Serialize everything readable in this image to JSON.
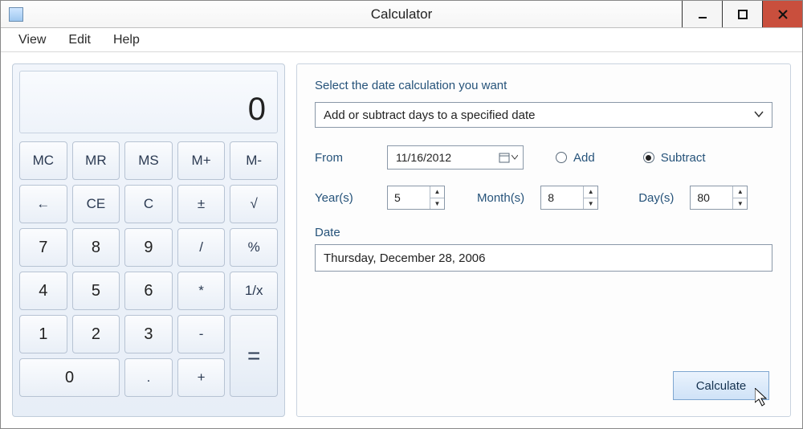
{
  "window": {
    "title": "Calculator"
  },
  "menu": {
    "view": "View",
    "edit": "Edit",
    "help": "Help"
  },
  "calc": {
    "display": "0",
    "keys": {
      "mc": "MC",
      "mr": "MR",
      "ms": "MS",
      "mplus": "M+",
      "mminus": "M-",
      "back": "←",
      "ce": "CE",
      "c": "C",
      "pm": "±",
      "sqrt": "√",
      "k7": "7",
      "k8": "8",
      "k9": "9",
      "div": "/",
      "pct": "%",
      "k4": "4",
      "k5": "5",
      "k6": "6",
      "mul": "*",
      "inv": "1/x",
      "k1": "1",
      "k2": "2",
      "k3": "3",
      "sub": "-",
      "eq": "=",
      "k0": "0",
      "dot": ".",
      "add": "+"
    }
  },
  "datecalc": {
    "instruction": "Select the date calculation you want",
    "mode": "Add or subtract days to a specified date",
    "from_label": "From",
    "from_value": "11/16/2012",
    "add_label": "Add",
    "subtract_label": "Subtract",
    "selected_op": "subtract",
    "years_label": "Year(s)",
    "years_value": "5",
    "months_label": "Month(s)",
    "months_value": "8",
    "days_label": "Day(s)",
    "days_value": "80",
    "result_label": "Date",
    "result_value": "Thursday, December 28, 2006",
    "calculate_button": "Calculate"
  }
}
